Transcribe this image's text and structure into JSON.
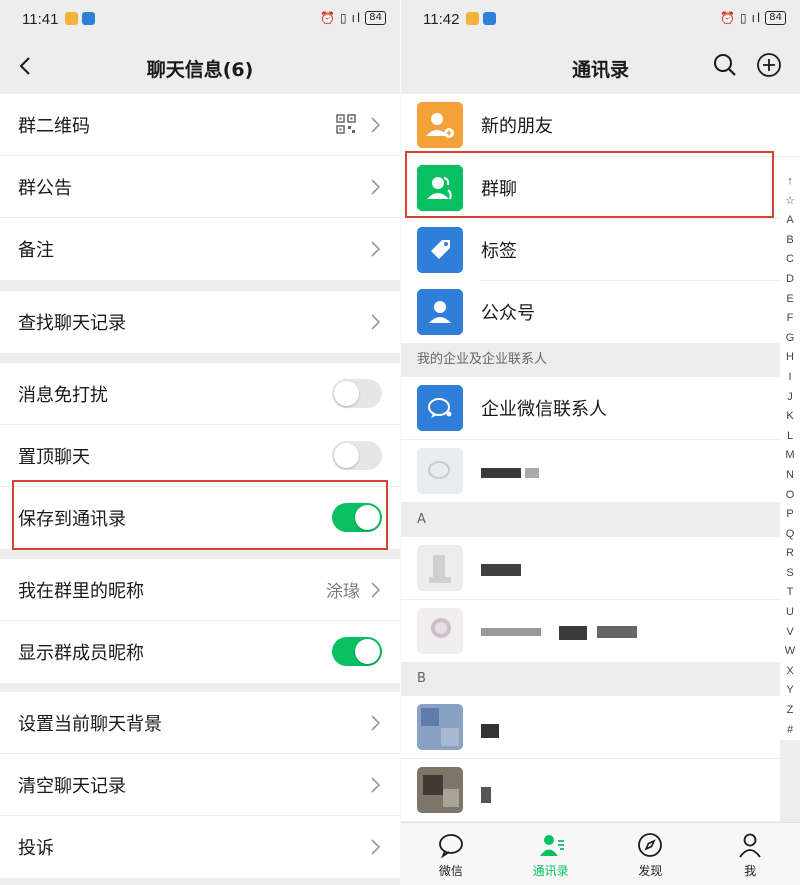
{
  "left": {
    "status": {
      "time": "11:41",
      "battery": "84"
    },
    "nav": {
      "title": "聊天信息(6)"
    },
    "rows": {
      "qr": "群二维码",
      "notice": "群公告",
      "remark": "备注",
      "search_history": "查找聊天记录",
      "mute": "消息免打扰",
      "pin": "置顶聊天",
      "save_contacts": "保存到通讯录",
      "my_nickname": "我在群里的昵称",
      "my_nickname_value": "涂瑑",
      "show_nicknames": "显示群成员昵称",
      "set_background": "设置当前聊天背景",
      "clear_history": "清空聊天记录",
      "complain": "投诉"
    },
    "toggles": {
      "mute": false,
      "pin": false,
      "save_contacts": true,
      "show_nicknames": true
    }
  },
  "right": {
    "status": {
      "time": "11:42",
      "battery": "84"
    },
    "nav": {
      "title": "通讯录"
    },
    "items": {
      "new_friends": "新的朋友",
      "group_chats": "群聊",
      "tags": "标签",
      "official_accounts": "公众号",
      "enterprise_contacts": "企业微信联系人"
    },
    "sections": {
      "enterprise": "我的企业及企业联系人",
      "a": "A",
      "b": "B"
    },
    "index": [
      "↑",
      "☆",
      "A",
      "B",
      "C",
      "D",
      "E",
      "F",
      "G",
      "H",
      "I",
      "J",
      "K",
      "L",
      "M",
      "N",
      "O",
      "P",
      "Q",
      "R",
      "S",
      "T",
      "U",
      "V",
      "W",
      "X",
      "Y",
      "Z",
      "#"
    ],
    "tabs": [
      "微信",
      "通讯录",
      "发现",
      "我"
    ],
    "active_tab": "通讯录"
  },
  "colors": {
    "accent": "#07c160",
    "highlight": "#d6432f",
    "icon_orange": "#f5a13a",
    "icon_green": "#07c160",
    "icon_blue": "#2f7fd8"
  }
}
